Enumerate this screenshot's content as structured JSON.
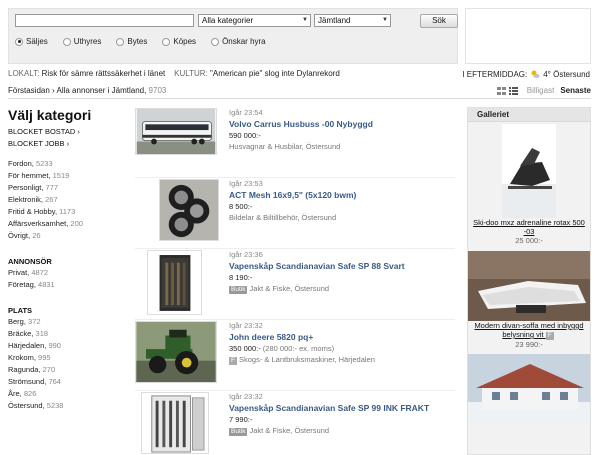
{
  "search": {
    "query": "",
    "category": "Alla kategorier",
    "region": "Jämtland",
    "button": "Sök",
    "types": [
      {
        "label": "Säljes",
        "checked": true
      },
      {
        "label": "Uthyres",
        "checked": false
      },
      {
        "label": "Bytes",
        "checked": false
      },
      {
        "label": "Köpes",
        "checked": false
      },
      {
        "label": "Önskar hyra",
        "checked": false
      }
    ]
  },
  "news": {
    "local_tag": "LOKALT:",
    "local_text": "Risk för sämre rättssäkerhet i länet",
    "culture_tag": "KULTUR:",
    "culture_text": "\"American pie\" slog inte Dylanrekord"
  },
  "weather": {
    "label": "I EFTERMIDDAG:",
    "value": "4° Östersund",
    "icon": "sun-cloud-icon"
  },
  "breadcrumb": {
    "home": "Förstasidan",
    "sep": "›",
    "current": "Alla annonser i Jämtland,",
    "count": "9703"
  },
  "sort": {
    "cheapest": "Billigast",
    "newest": "Senaste"
  },
  "sidebar": {
    "heading": "Välj kategori",
    "blocket_links": [
      "BLOCKET BOSTAD ›",
      "BLOCKET JOBB ›"
    ],
    "categories": [
      {
        "name": "Fordon,",
        "count": "5233"
      },
      {
        "name": "För hemmet,",
        "count": "1519"
      },
      {
        "name": "Personligt,",
        "count": "777"
      },
      {
        "name": "Elektronik,",
        "count": "267"
      },
      {
        "name": "Fritid & Hobby,",
        "count": "1173"
      },
      {
        "name": "Affärsverksamhet,",
        "count": "200"
      },
      {
        "name": "Övrigt,",
        "count": "26"
      }
    ],
    "advertiser_heading": "ANNONSÖR",
    "advertisers": [
      {
        "name": "Privat,",
        "count": "4872"
      },
      {
        "name": "Företag,",
        "count": "4831"
      }
    ],
    "place_heading": "PLATS",
    "places": [
      {
        "name": "Berg,",
        "count": "372"
      },
      {
        "name": "Bräcke,",
        "count": "318"
      },
      {
        "name": "Härjedalen,",
        "count": "990"
      },
      {
        "name": "Krokom,",
        "count": "995"
      },
      {
        "name": "Ragunda,",
        "count": "270"
      },
      {
        "name": "Strömsund,",
        "count": "764"
      },
      {
        "name": "Åre,",
        "count": "826"
      },
      {
        "name": "Östersund,",
        "count": "5238"
      }
    ]
  },
  "listings": [
    {
      "time": "Igår 23:54",
      "title": "Volvo Carrus Husbuss -00 Nybyggd",
      "price": "590 000:-",
      "badge": "",
      "meta": "Husvagnar & Husbilar, Östersund",
      "image": "bus"
    },
    {
      "time": "Igår 23:53",
      "title": "ACT Mesh 16x9,5\" (5x120 bwm)",
      "price": "8 500:-",
      "badge": "",
      "meta": "Bildelar & Biltillbehör, Östersund",
      "image": "wheels"
    },
    {
      "time": "Igår 23:36",
      "title": "Vapenskåp Scandianavian Safe SP 88 Svart",
      "price": "8 190:-",
      "badge": "Butik",
      "meta": "Jakt & Fiske, Östersund",
      "image": "safe"
    },
    {
      "time": "Igår 23:32",
      "title": "John deere 5820 pq+",
      "price": "350 000:-",
      "price_extra": "(280 000:- ex. moms)",
      "badge": "F",
      "meta": "Skogs- & Lantbruksmaskiner, Härjedalen",
      "image": "tractor"
    },
    {
      "time": "Igår 23:32",
      "title": "Vapenskåp Scandianavian Safe SP 99 INK FRAKT",
      "price": "7 990:-",
      "badge": "Butik",
      "meta": "Jakt & Fiske, Östersund",
      "image": "safe-open"
    }
  ],
  "gallery": {
    "heading": "Galleriet",
    "items": [
      {
        "caption": "Ski-doo mxz adrenaline rotax 500 -03",
        "price": "25 000:-"
      },
      {
        "caption": "Modern divan-soffa med inbyggd belysning vit",
        "badge": "F",
        "price": "23 990:-"
      },
      {
        "caption": "",
        "price": ""
      }
    ]
  },
  "colors": {
    "link": "#3a5a86",
    "panel": "#efefef",
    "badge": "#999999"
  }
}
